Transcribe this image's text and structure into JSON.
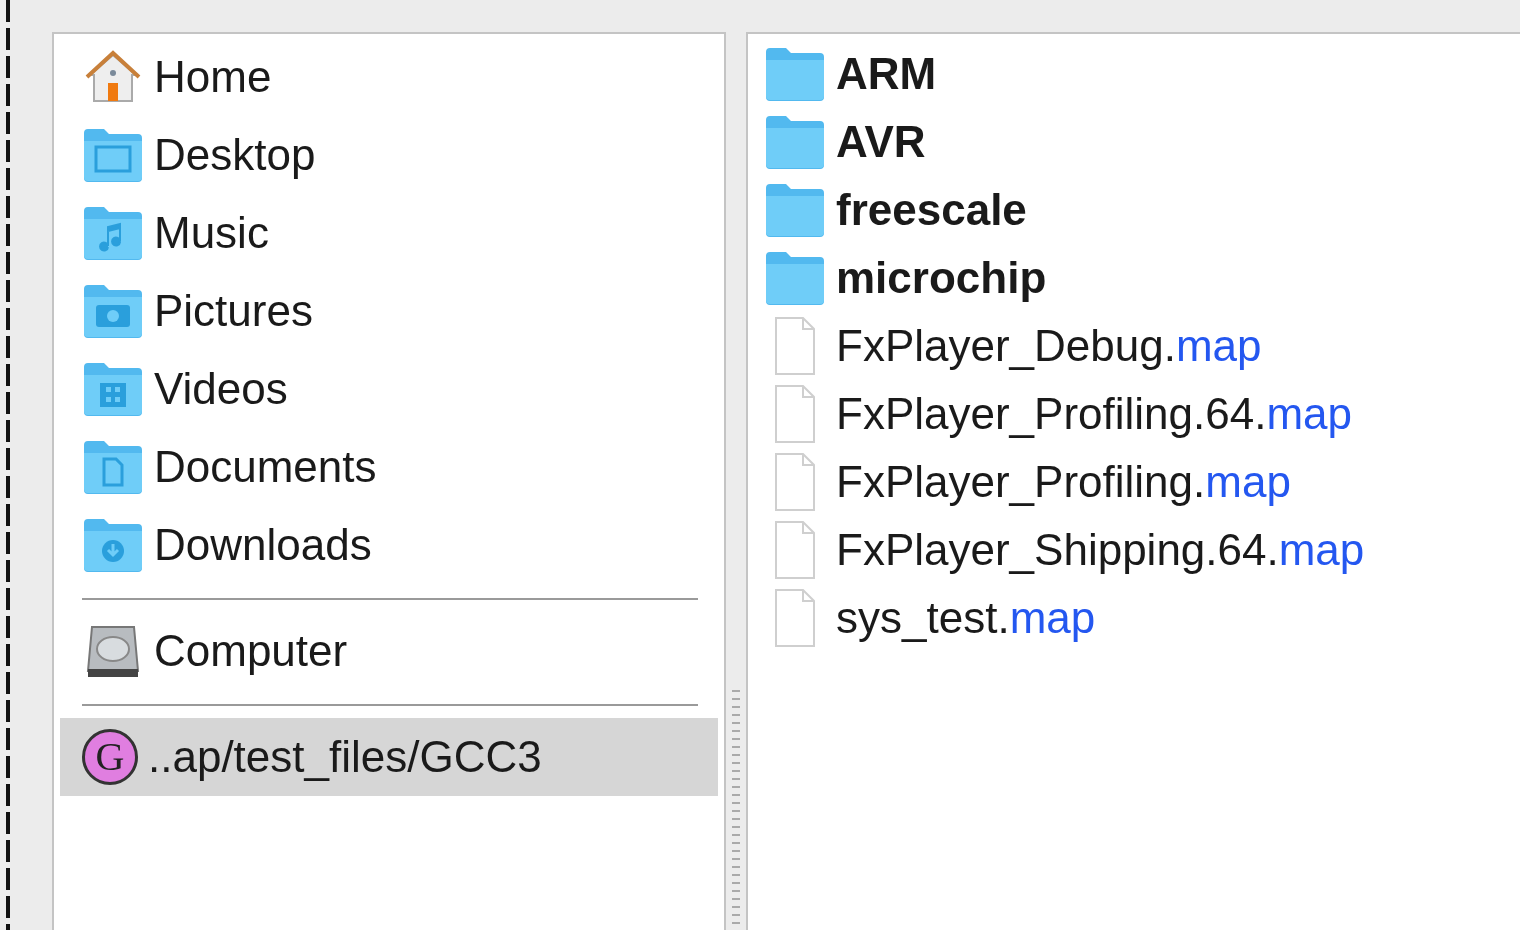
{
  "places": {
    "sections": [
      {
        "items": [
          {
            "kind": "home",
            "label": "Home",
            "selected": false
          },
          {
            "kind": "desktop",
            "label": "Desktop",
            "selected": false
          },
          {
            "kind": "music",
            "label": "Music",
            "selected": false
          },
          {
            "kind": "pictures",
            "label": "Pictures",
            "selected": false
          },
          {
            "kind": "videos",
            "label": "Videos",
            "selected": false
          },
          {
            "kind": "documents",
            "label": "Documents",
            "selected": false
          },
          {
            "kind": "downloads",
            "label": "Downloads",
            "selected": false
          }
        ]
      },
      {
        "items": [
          {
            "kind": "computer",
            "label": "Computer",
            "selected": false
          }
        ]
      },
      {
        "items": [
          {
            "kind": "bookmark",
            "badge": "G",
            "label": "..ap/test_files/GCC3",
            "selected": true
          }
        ]
      }
    ]
  },
  "files": [
    {
      "kind": "folder",
      "name": "ARM"
    },
    {
      "kind": "folder",
      "name": "AVR"
    },
    {
      "kind": "folder",
      "name": "freescale"
    },
    {
      "kind": "folder",
      "name": "microchip"
    },
    {
      "kind": "file",
      "name": "FxPlayer_Debug.",
      "extension": "map"
    },
    {
      "kind": "file",
      "name": "FxPlayer_Profiling.64.",
      "extension": "map"
    },
    {
      "kind": "file",
      "name": "FxPlayer_Profiling.",
      "extension": "map"
    },
    {
      "kind": "file",
      "name": "FxPlayer_Shipping.64.",
      "extension": "map"
    },
    {
      "kind": "file",
      "name": "sys_test.",
      "extension": "map"
    }
  ]
}
